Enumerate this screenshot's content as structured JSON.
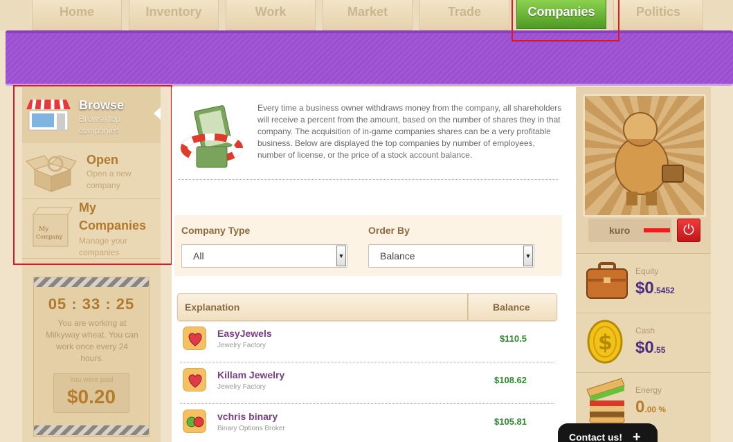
{
  "nav": {
    "tabs": [
      {
        "label": "Home"
      },
      {
        "label": "Inventory"
      },
      {
        "label": "Work"
      },
      {
        "label": "Market"
      },
      {
        "label": "Trade"
      },
      {
        "label": "Companies"
      },
      {
        "label": "Politics"
      }
    ],
    "active_tab": "Companies"
  },
  "sidebar": {
    "items": [
      {
        "title": "Browse",
        "sub1": "Browse top",
        "sub2": "companies",
        "icon": "shop-icon"
      },
      {
        "title": "Open",
        "sub1": "Open a new",
        "sub2": "company",
        "icon": "open-box-icon"
      },
      {
        "title1": "My",
        "title2": "Companies",
        "sub1": "Manage your",
        "sub2": "companies",
        "icon": "my-company-box-icon"
      }
    ]
  },
  "work": {
    "timer": "05 : 33 : 25",
    "message": "You are working at Milkyway wheat. You can work once every 24 hours.",
    "paid_label": "You were paid",
    "paid_value": "$0.20"
  },
  "intro_text": "Every time a business owner withdraws money from the company, all shareholders will receive a percent from the amount, based on the number of shares they in that company. The acquisition of in-game companies shares can be a very profitable business. Below are displayed the top companies by number of employees, number of license, or the price of a stock account balance.",
  "filters": {
    "company_type_label": "Company Type",
    "company_type_value": "All",
    "order_by_label": "Order By",
    "order_by_value": "Balance"
  },
  "table": {
    "headers": [
      "Explanation",
      "Balance"
    ],
    "rows": [
      {
        "name": "EasyJewels",
        "type": "Jewelry Factory",
        "balance": "$110.5",
        "icon": "jewel-heart-icon"
      },
      {
        "name": "Killam Jewelry",
        "type": "Jewelry Factory",
        "balance": "$108.62",
        "icon": "jewel-heart-icon"
      },
      {
        "name": "vchris binary",
        "type": "Binary Options Broker",
        "balance": "$105.81",
        "icon": "binary-balls-icon"
      }
    ]
  },
  "user": {
    "name": "kuro",
    "equity_label": "Equity",
    "equity_main": "$0",
    "equity_cents": ".5452",
    "cash_label": "Cash",
    "cash_main": "$0",
    "cash_cents": ".55",
    "energy_label": "Energy",
    "energy_main": "0",
    "energy_cents": ".00 %"
  },
  "contact": {
    "label": "Contact us!",
    "icon": "plus-icon"
  },
  "colors": {
    "accent_purple": "#a257d5",
    "active_tab_green": "#5ea92f",
    "highlight_red": "#e0191f",
    "balance_green": "#2c8a2c"
  }
}
